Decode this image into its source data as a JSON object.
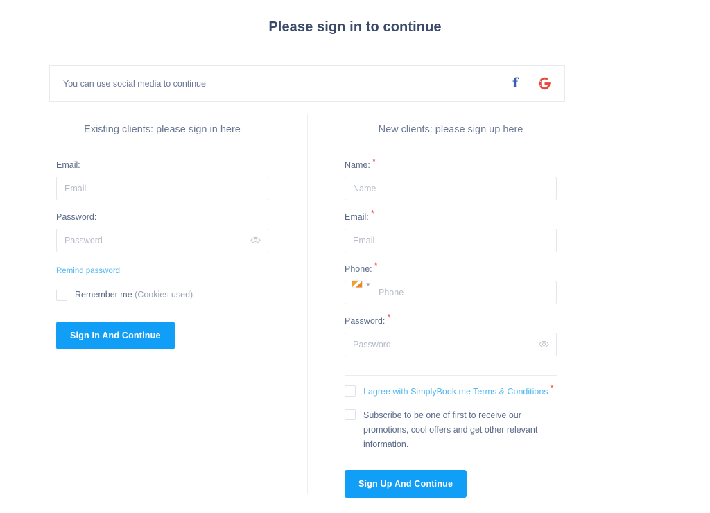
{
  "page": {
    "title": "Please sign in to continue"
  },
  "social": {
    "text": "You can use social media to continue",
    "facebook_icon": "facebook-icon",
    "google_icon": "google-icon",
    "facebook_glyph": "f",
    "facebook_color": "#3b5bb5",
    "google_color": "#e8453c"
  },
  "signin": {
    "heading": "Existing clients: please sign in here",
    "email_label": "Email:",
    "email_placeholder": "Email",
    "email_value": "",
    "password_label": "Password:",
    "password_placeholder": "Password",
    "password_value": "",
    "remind_link": "Remind password",
    "remember_label": "Remember me ",
    "remember_note": "(Cookies used)",
    "submit_label": "Sign In And Continue"
  },
  "signup": {
    "heading": "New clients: please sign up here",
    "required_mark": "*",
    "name_label": "Name:",
    "name_placeholder": "Name",
    "name_value": "",
    "email_label": "Email:",
    "email_placeholder": "Email",
    "email_value": "",
    "phone_label": "Phone:",
    "phone_placeholder": "Phone",
    "phone_value": "",
    "password_label": "Password:",
    "password_placeholder": "Password",
    "password_value": "",
    "terms_label": "I agree with SimplyBook.me Terms & Conditions",
    "subscribe_label": "Subscribe to be one of first to receive our promotions, cool offers and get other relevant information.",
    "submit_label": "Sign Up And Continue"
  },
  "theme": {
    "accent": "#119ef7",
    "link": "#53b9f0",
    "required": "#e8524a",
    "heading": "#3b4a6b",
    "text": "#5c6b8a"
  }
}
